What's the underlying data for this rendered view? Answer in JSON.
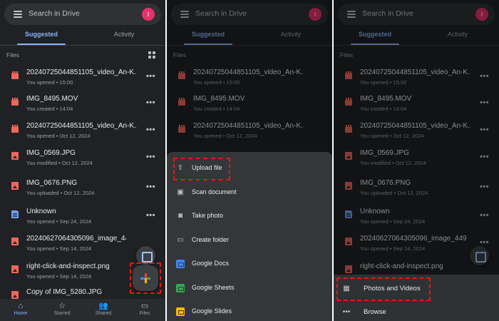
{
  "search": {
    "placeholder": "Search in Drive"
  },
  "user": {
    "avatar_letter": "I",
    "avatar_color": "#e8316a"
  },
  "tabs": [
    {
      "label": "Suggested",
      "active": true
    },
    {
      "label": "Activity",
      "active": false
    }
  ],
  "files_section": {
    "label": "Files",
    "view_toggle_icon": "grid-icon"
  },
  "files": [
    {
      "name": "20240725044851105_video_An-K...",
      "meta": "You opened • 15:00",
      "type": "video",
      "meta_icon": ""
    },
    {
      "name": "IMG_8495.MOV",
      "meta": "You created • 14:04",
      "type": "video",
      "meta_icon": ""
    },
    {
      "name": "20240725044851105_video_An-K...",
      "meta": "You opened • Oct 12, 2024",
      "type": "video",
      "meta_icon": ""
    },
    {
      "name": "IMG_0569.JPG",
      "meta": "You modified • Oct 12, 2024",
      "type": "image",
      "meta_icon": "shared-icon"
    },
    {
      "name": "IMG_0676.PNG",
      "meta": "You uploaded • Oct 12, 2024",
      "type": "image",
      "meta_icon": "shared-icon"
    },
    {
      "name": "Unknown",
      "meta": "You opened • Sep 24, 2024",
      "type": "doc",
      "meta_icon": "shared-icon"
    },
    {
      "name": "20240627064305096_image_449...",
      "meta": "You opened • Sep 14, 2024",
      "type": "image",
      "meta_icon": "shared-icon"
    },
    {
      "name": "right-click-and-inspect.png",
      "meta": "You opened • Sep 14, 2024",
      "type": "image",
      "meta_icon": "shared-icon"
    },
    {
      "name": "Copy of IMG_5280.JPG",
      "meta": "",
      "type": "image",
      "meta_icon": ""
    }
  ],
  "more_glyph": "•••",
  "bottom_nav": [
    {
      "label": "Home",
      "icon": "home-icon",
      "glyph": "⌂",
      "active": true
    },
    {
      "label": "Starred",
      "icon": "star-icon",
      "glyph": "☆",
      "active": false
    },
    {
      "label": "Shared",
      "icon": "people-icon",
      "glyph": "👥",
      "active": false
    },
    {
      "label": "Files",
      "icon": "folder-icon",
      "glyph": "▭",
      "active": false
    }
  ],
  "new_menu": [
    {
      "label": "Upload file",
      "icon": "upload-icon",
      "glyph": "⇪",
      "highlighted": true
    },
    {
      "label": "Scan document",
      "icon": "scan-icon",
      "glyph": "▣"
    },
    {
      "label": "Take photo",
      "icon": "camera-icon",
      "glyph": "◙"
    },
    {
      "label": "Create folder",
      "icon": "folder-icon",
      "glyph": "▭"
    },
    {
      "label": "Google Docs",
      "icon": "google-docs-icon",
      "glyph": ""
    },
    {
      "label": "Google Sheets",
      "icon": "google-sheets-icon",
      "glyph": ""
    },
    {
      "label": "Google Slides",
      "icon": "google-slides-icon",
      "glyph": ""
    }
  ],
  "upload_menu": [
    {
      "label": "Photos and Videos",
      "icon": "photos-icon",
      "glyph": "▦",
      "highlighted": true
    },
    {
      "label": "Browse",
      "icon": "more-icon",
      "glyph": "•••"
    }
  ],
  "colors": {
    "background": "#202124",
    "accent": "#8ab4f8",
    "highlight_box": "#e8180c",
    "video_icon": "#ee675c",
    "doc_icon": "#6fa0f5"
  }
}
